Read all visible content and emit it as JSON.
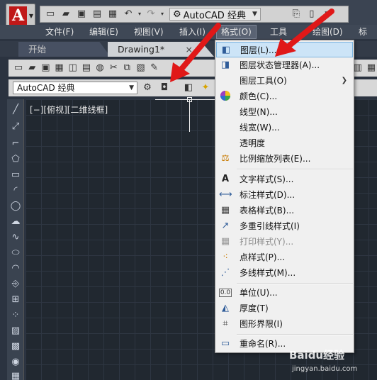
{
  "titlebar": {
    "workspace": "AutoCAD 经典",
    "app_button_glyph": "A",
    "qat_icons": [
      "new-icon",
      "open-icon",
      "save-icon",
      "saveas-icon",
      "print-icon",
      "undo-icon",
      "redo-icon",
      "gear-icon",
      "phone-icon"
    ]
  },
  "menubar": {
    "items": [
      "文件(F)",
      "编辑(E)",
      "视图(V)",
      "插入(I)",
      "格式(O)",
      "工具",
      "绘图(D)",
      "标注"
    ]
  },
  "tabs": {
    "items": [
      "开始",
      "Drawing1*"
    ],
    "close": "×"
  },
  "toolbar2": {
    "workspace_select": "AutoCAD 经典"
  },
  "viewport": {
    "label": "[−][俯视][二维线框]"
  },
  "format_menu": {
    "items": [
      {
        "icon": "layer-icon",
        "label": "图层(L)...",
        "highlighted": true
      },
      {
        "icon": "layer-state-icon",
        "label": "图层状态管理器(A)..."
      },
      {
        "icon": "",
        "label": "图层工具(O)",
        "submenu": "❯"
      },
      {
        "icon": "color-wheel-icon",
        "label": "颜色(C)..."
      },
      {
        "icon": "",
        "label": "线型(N)..."
      },
      {
        "icon": "",
        "label": "线宽(W)..."
      },
      {
        "icon": "",
        "label": "透明度"
      },
      {
        "icon": "scale-list-icon",
        "label": "比例缩放列表(E)..."
      },
      {
        "icon": "text-style-icon",
        "label": "文字样式(S)..."
      },
      {
        "icon": "dim-style-icon",
        "label": "标注样式(D)..."
      },
      {
        "icon": "table-style-icon",
        "label": "表格样式(B)..."
      },
      {
        "icon": "mleader-style-icon",
        "label": "多重引线样式(I)"
      },
      {
        "icon": "plot-style-icon",
        "label": "打印样式(Y)...",
        "disabled": true
      },
      {
        "icon": "point-style-icon",
        "label": "点样式(P)..."
      },
      {
        "icon": "mline-style-icon",
        "label": "多线样式(M)..."
      },
      {
        "icon": "units-icon",
        "label": "单位(U)..."
      },
      {
        "icon": "thickness-icon",
        "label": "厚度(T)"
      },
      {
        "icon": "limits-icon",
        "label": "图形界限(I)"
      },
      {
        "icon": "rename-icon",
        "label": "重命名(R)..."
      }
    ]
  },
  "colors": {
    "accent_red": "#e01818",
    "menu_highlight": "#cce4f7",
    "canvas_bg": "#212830"
  },
  "watermark": {
    "brand": "Baidu经验",
    "url": "jingyan.baidu.com"
  }
}
